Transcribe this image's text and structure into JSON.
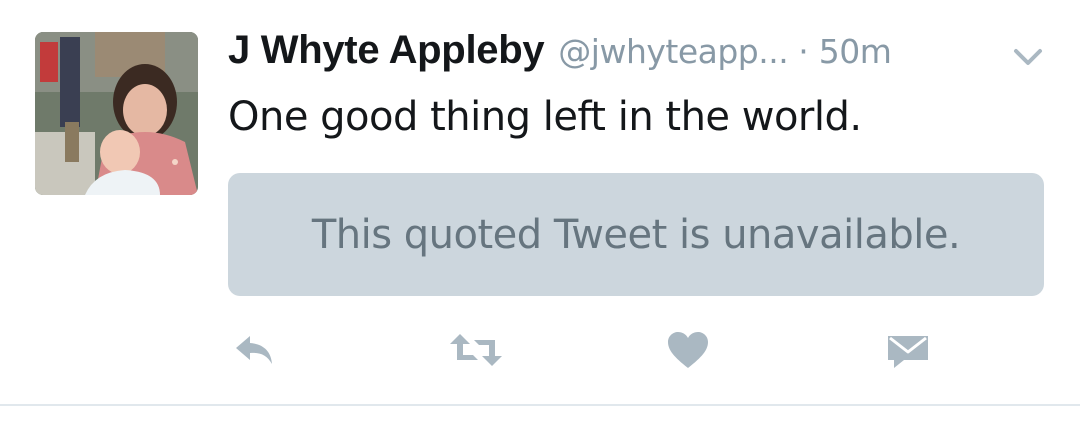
{
  "tweet": {
    "author_name": "J Whyte Appleby",
    "author_handle": "@jwhyteapp...",
    "separator": "·",
    "timestamp": "50m",
    "text": "One good thing left in the world.",
    "quoted_tweet_text": "This quoted Tweet is unavailable."
  },
  "icons": {
    "menu": "chevron-down-icon",
    "reply": "reply-icon",
    "retweet": "retweet-icon",
    "like": "heart-icon",
    "dm": "envelope-icon"
  },
  "colors": {
    "name": "#14171a",
    "secondary_text": "#8899a6",
    "quote_background": "#ccd6dd",
    "quote_text": "#66757f",
    "action_icon": "#aab8c2",
    "divider": "#e1e8ed"
  }
}
